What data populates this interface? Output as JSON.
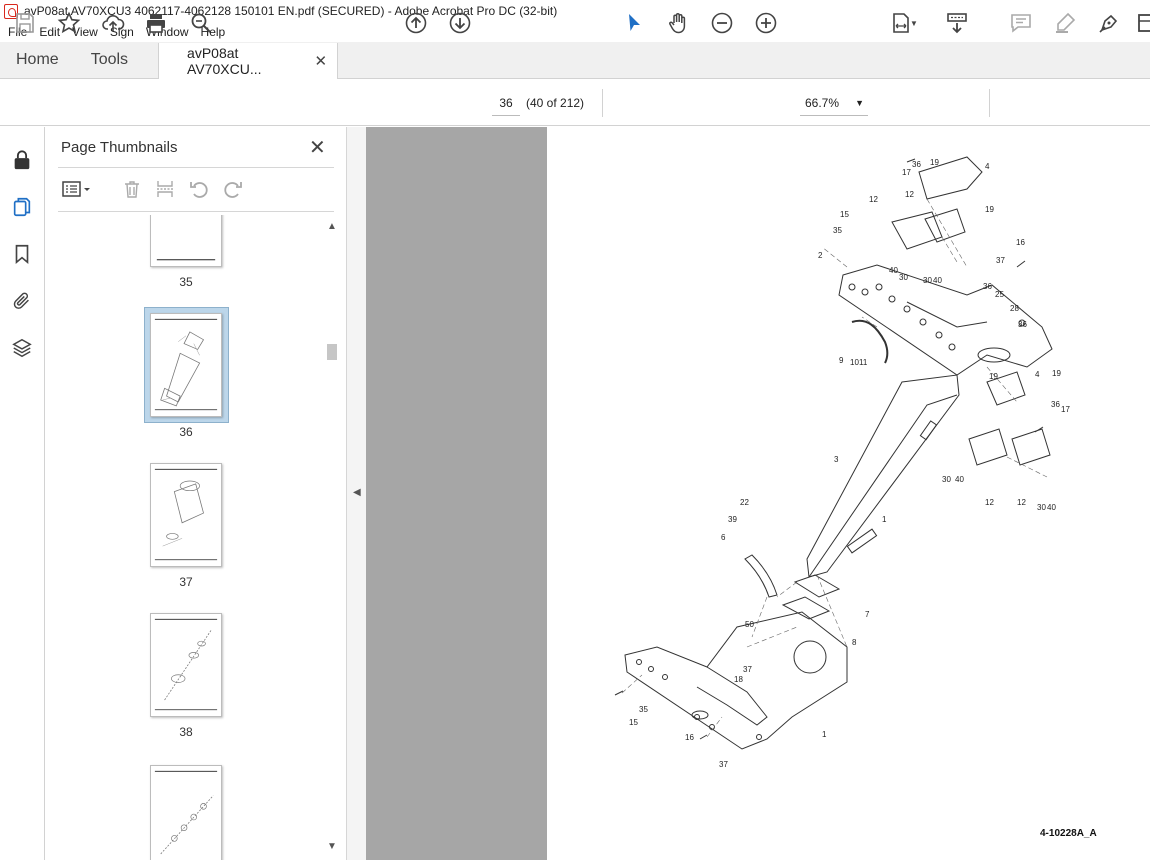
{
  "window": {
    "title": "avP08at AV70XCU3 4062117-4062128 150101 EN.pdf (SECURED) - Adobe Acrobat Pro DC (32-bit)"
  },
  "menu": [
    "File",
    "Edit",
    "View",
    "Sign",
    "Window",
    "Help"
  ],
  "tabs": {
    "home": "Home",
    "tools": "Tools",
    "document": "avP08at AV70XCU..."
  },
  "toolbar": {
    "page_number": "36",
    "page_count": "(40 of 212)",
    "zoom": "66.7%"
  },
  "panel": {
    "title": "Page Thumbnails",
    "thumbnails": [
      {
        "label": "35"
      },
      {
        "label": "36",
        "selected": true
      },
      {
        "label": "37"
      },
      {
        "label": "38"
      }
    ]
  },
  "document": {
    "drawing_code": "4-10228A_A"
  }
}
